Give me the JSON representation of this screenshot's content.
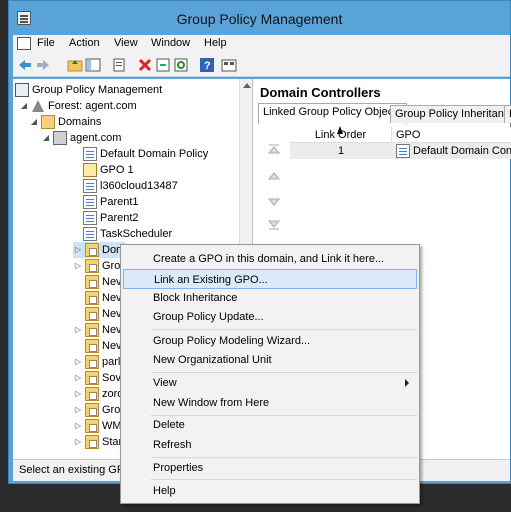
{
  "window": {
    "title": "Group Policy Management"
  },
  "menubar": {
    "items": [
      "File",
      "Action",
      "View",
      "Window",
      "Help"
    ]
  },
  "toolbar": {
    "icons": [
      "back-arrow-icon",
      "forward-arrow-icon",
      "up-folder-icon",
      "show-tree-icon",
      "properties-icon",
      "delete-icon",
      "export-icon",
      "refresh-icon",
      "help-icon",
      "console-icon"
    ]
  },
  "tree": {
    "root": "Group Policy Management",
    "forest": "Forest: agent.com",
    "domains": "Domains",
    "domain": "agent.com",
    "gpos": [
      "Default Domain Policy",
      "GPO 1",
      "l360cloud13487",
      "Parent1",
      "Parent2",
      "TaskScheduler"
    ],
    "ous": [
      "Dom",
      "Gro",
      "Nev",
      "Nev",
      "Nev",
      "Nev",
      "Nev",
      "parl",
      "Sov",
      "zoro",
      "Gro",
      "WM",
      "Star"
    ]
  },
  "right": {
    "title": "Domain Controllers",
    "tabs": [
      "Linked Group Policy Objects",
      "Group Policy Inheritance",
      "D"
    ],
    "columns": [
      "Link Order",
      "GPO"
    ],
    "rows": [
      {
        "link_order": "1",
        "gpo": "Default Domain Con..."
      }
    ]
  },
  "context_menu": {
    "items": [
      "Create a GPO in this domain, and Link it here...",
      "Link an Existing GPO...",
      "Block Inheritance",
      "Group Policy Update...",
      "Group Policy Modeling Wizard...",
      "New Organizational Unit",
      "View",
      "New Window from Here",
      "Delete",
      "Refresh",
      "Properties",
      "Help"
    ],
    "highlighted": "Link an Existing GPO..."
  },
  "statusbar": {
    "text": "Select an existing GPO"
  },
  "colors": {
    "titlebar": "#5aa3d9",
    "highlight": "#dbeaf9",
    "highlight_border": "#80b4ea"
  }
}
